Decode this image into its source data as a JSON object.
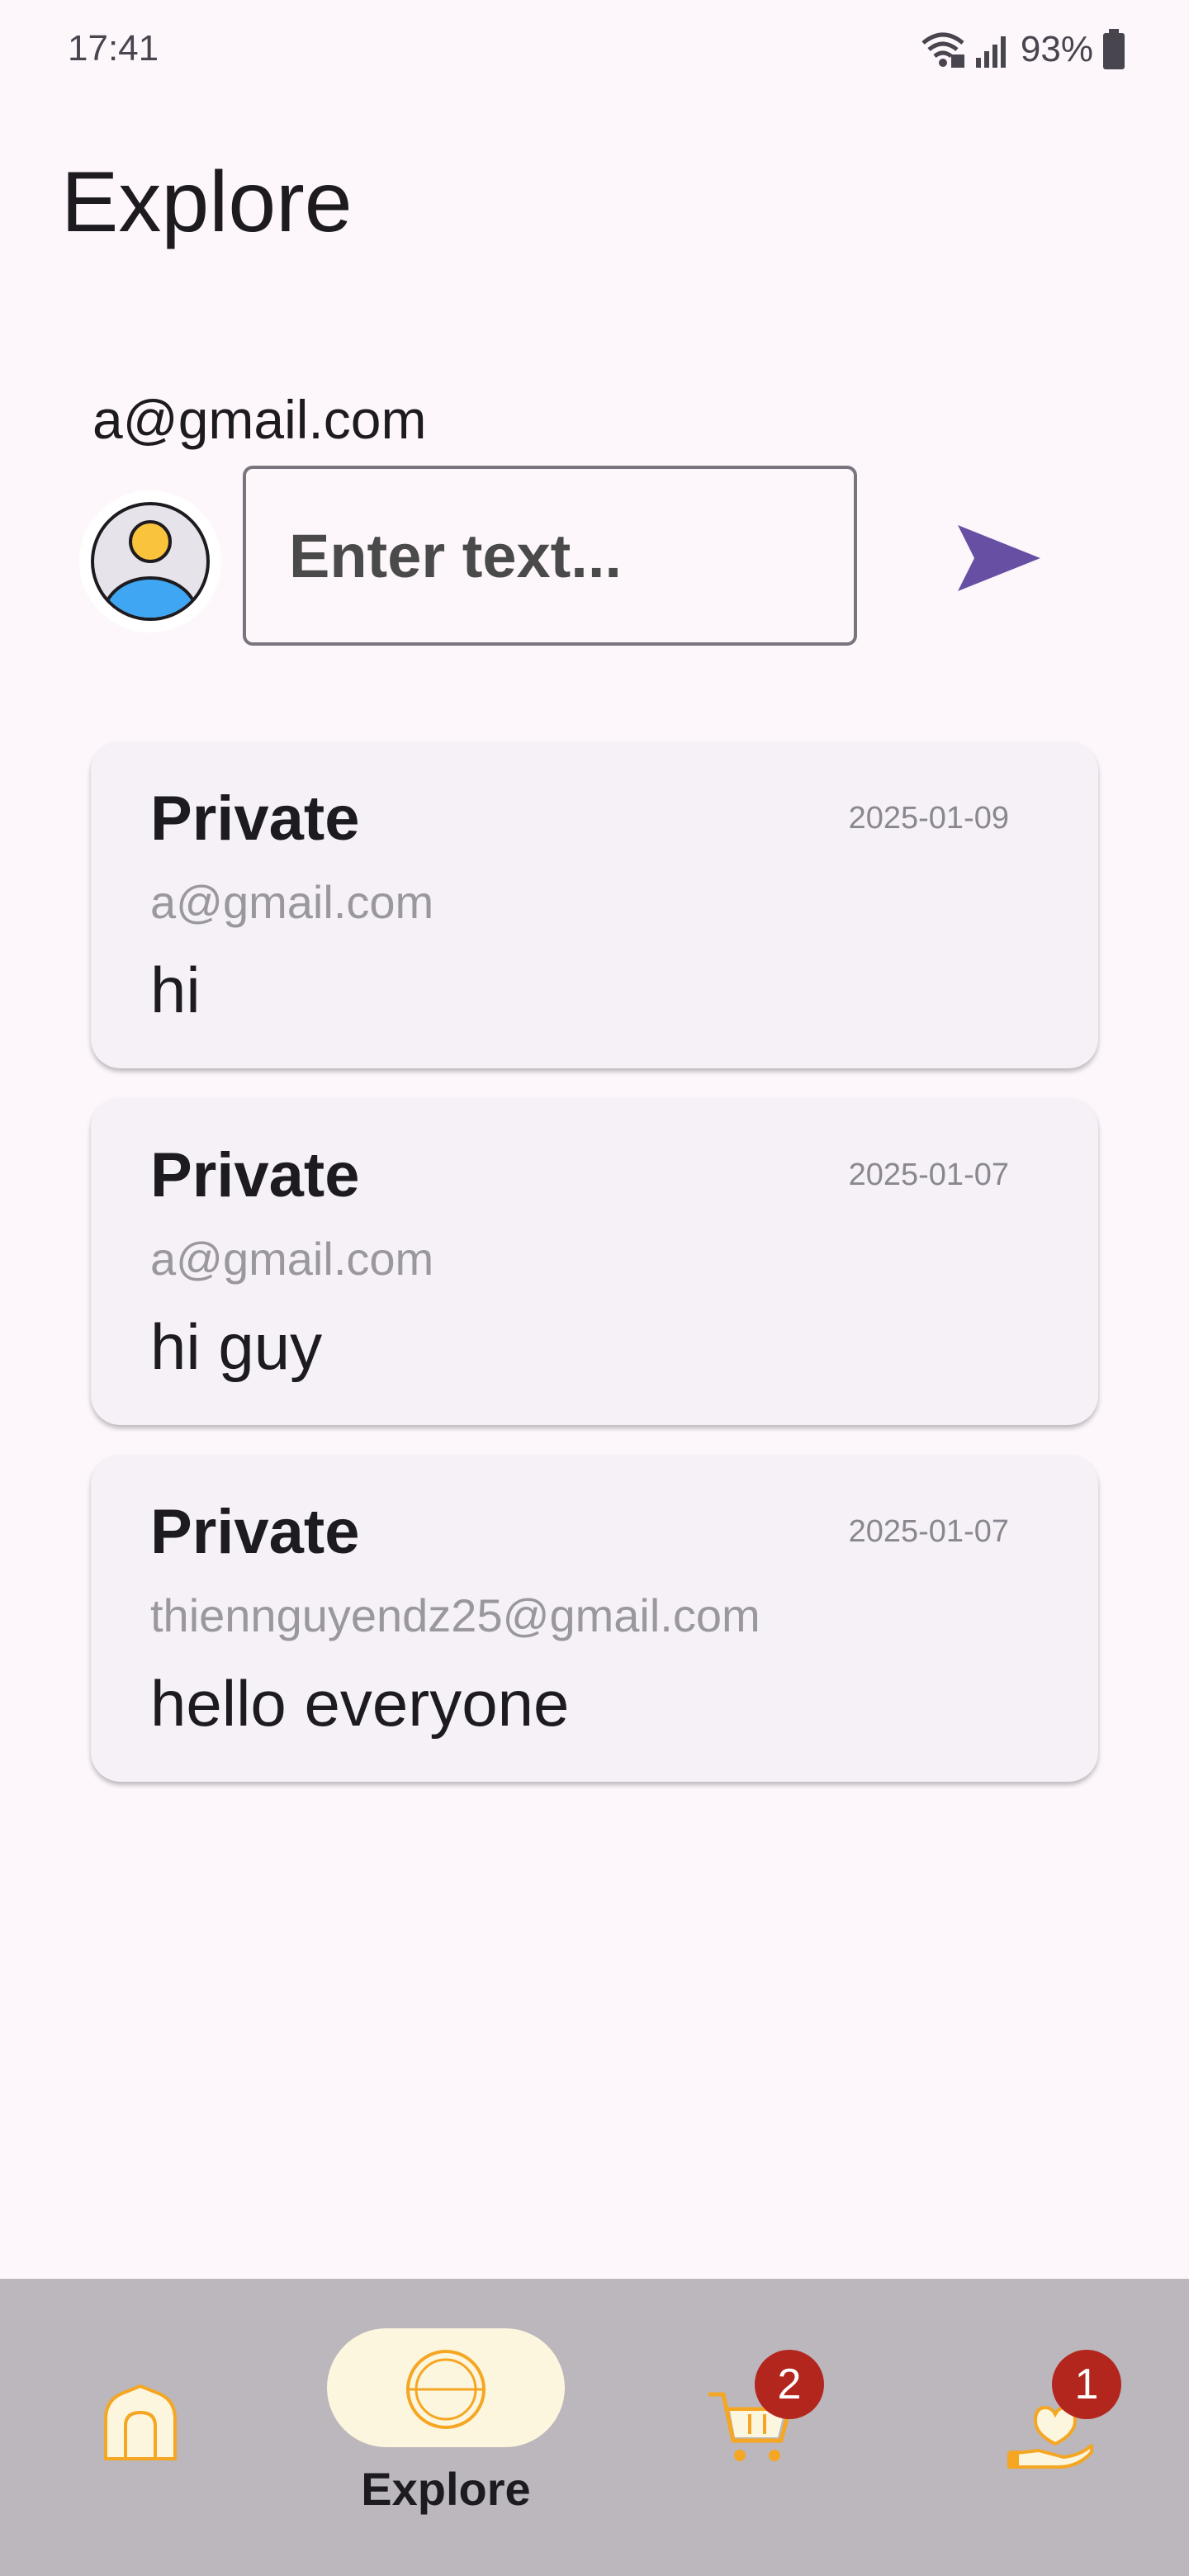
{
  "status_bar": {
    "time": "17:41",
    "battery": "93%",
    "icons": [
      "wifi-icon",
      "signal-icon",
      "battery-icon"
    ]
  },
  "page": {
    "title": "Explore"
  },
  "composer": {
    "user_email": "a@gmail.com",
    "placeholder": "Enter text...",
    "send_icon": "send-icon"
  },
  "posts": [
    {
      "title": "Private",
      "date": "2025-01-09",
      "author": "a@gmail.com",
      "text": "hi"
    },
    {
      "title": "Private",
      "date": "2025-01-07",
      "author": "a@gmail.com",
      "text": "hi guy"
    },
    {
      "title": "Private",
      "date": "2025-01-07",
      "author": "thiennguyendz25@gmail.com",
      "text": "hello everyone"
    }
  ],
  "nav": {
    "explore_label": "Explore",
    "cart_badge": "2",
    "donate_badge": "1",
    "icons": [
      "home-icon",
      "explore-icon",
      "cart-icon",
      "donate-icon"
    ]
  },
  "colors": {
    "background": "#fdf7fc",
    "accent": "#6750a4",
    "nav_icon": "#f5a623",
    "badge": "#b3261e",
    "nav_background": "#bbb7bc"
  }
}
